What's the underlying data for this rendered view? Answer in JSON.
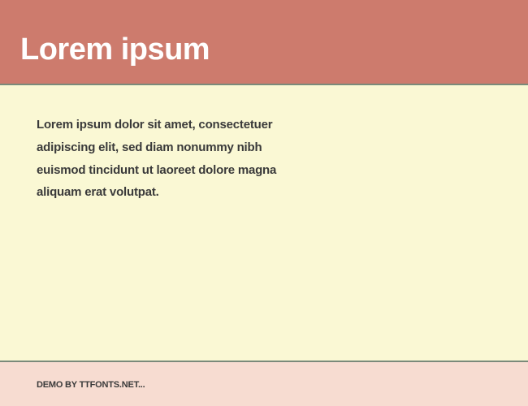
{
  "header": {
    "title": "Lorem ipsum"
  },
  "content": {
    "body": "Lorem ipsum dolor sit amet, consectetuer adipiscing elit, sed diam nonummy nibh euismod tincidunt ut laoreet dolore magna aliquam erat volutpat."
  },
  "footer": {
    "text": "DEMO BY TTFONTS.NET..."
  }
}
